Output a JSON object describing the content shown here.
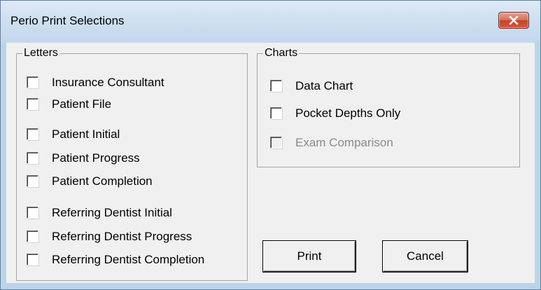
{
  "window": {
    "title": "Perio Print Selections"
  },
  "letters": {
    "legend": "Letters",
    "items": [
      {
        "label": "Insurance Consultant",
        "checked": false
      },
      {
        "label": "Patient File",
        "checked": false
      },
      {
        "label": "Patient Initial",
        "checked": false
      },
      {
        "label": "Patient Progress",
        "checked": false
      },
      {
        "label": "Patient Completion",
        "checked": false
      },
      {
        "label": "Referring Dentist Initial",
        "checked": false
      },
      {
        "label": "Referring Dentist Progress",
        "checked": false
      },
      {
        "label": "Referring Dentist Completion",
        "checked": false
      }
    ]
  },
  "charts": {
    "legend": "Charts",
    "items": [
      {
        "label": "Data Chart",
        "checked": false,
        "enabled": true
      },
      {
        "label": "Pocket Depths Only",
        "checked": false,
        "enabled": true
      },
      {
        "label": "Exam Comparison",
        "checked": false,
        "enabled": false
      }
    ]
  },
  "buttons": {
    "print": "Print",
    "cancel": "Cancel"
  },
  "colors": {
    "frame": "#bcd4e9",
    "dialog_background": "#f0f0f0",
    "close_button": "#c8492f",
    "disabled_text": "#8a8a8a"
  }
}
